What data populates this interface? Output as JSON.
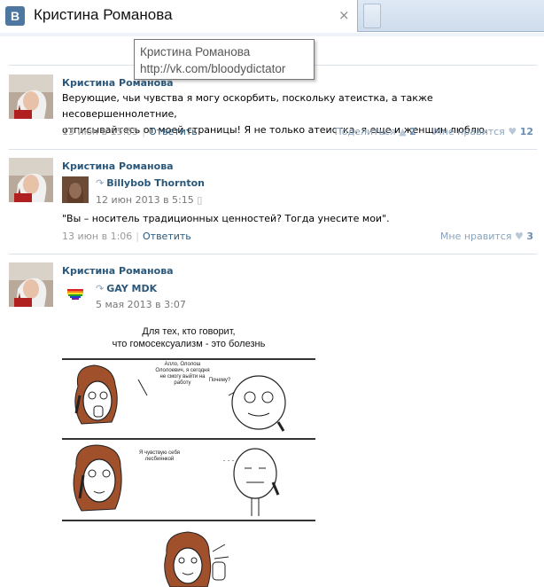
{
  "browser": {
    "tab_title": "Кристина Романова",
    "close_glyph": "×",
    "logo_letter": "В"
  },
  "tooltip": {
    "line1": "Кристина Романова",
    "line2": "http://vk.com/bloodydictator"
  },
  "posts": [
    {
      "author": "Кристина Романова",
      "text_line1": "Верующие, чьи чувства я могу оскорбить, поскольку атеистка, а также несовершеннолетние,",
      "text_line2": "отписывайтесь от моей страницы! Я не только атеистка, я еще и женщин люблю.",
      "date": "13 июн в 15:05",
      "reply": "Ответить",
      "share_label": "Поделиться",
      "share_count": "2",
      "like_label": "Мне нравится",
      "like_count": "12"
    },
    {
      "author": "Кристина Романова",
      "repost_name": "Billybob Thornton",
      "repost_date": "12 июн 2013 в 5:15",
      "text": "\"Вы – носитель традиционных ценностей? Тогда унесите мои\".",
      "date": "13 июн в 1:06",
      "reply": "Ответить",
      "like_label": "Мне нравится",
      "like_count": "3"
    },
    {
      "author": "Кристина Романова",
      "repost_name": "GAY MDK",
      "repost_date": "5 мая 2013 в 3:07",
      "comic_caption_line1": "Для тех, кто говорит,",
      "comic_caption_line2": "что гомосексуализм - это болезнь",
      "bubble1": "Алло, Ололош Ололоевич, я сегодня не смогу выйти на работу",
      "bubble2": "Почему?",
      "bubble3": "Я чувствую себя лесбиянкой",
      "bubble4": ". . ."
    }
  ],
  "colors": {
    "link": "#2b587a",
    "meta_gray": "#999999",
    "divider": "#dae1e8",
    "vk_blue": "#4d76a1"
  },
  "icons": {
    "share": "megaphone-icon",
    "like": "heart-icon",
    "repost": "repost-arrow-icon",
    "mobile": "phone-icon"
  }
}
